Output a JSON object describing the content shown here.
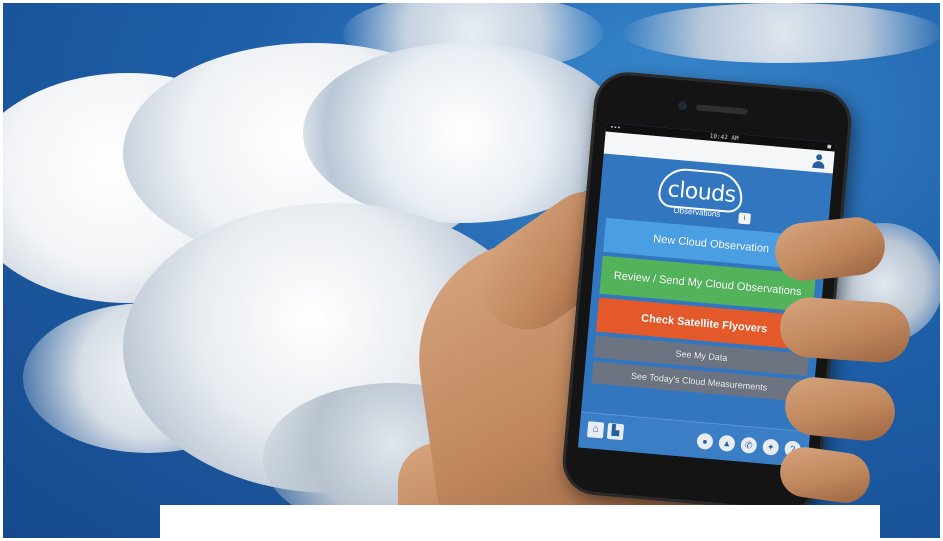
{
  "phone_app": {
    "status_bar": {
      "left": "•••",
      "center": "10:42 AM",
      "right": "■"
    },
    "logo": {
      "word": "clouds",
      "subtitle": "Observations",
      "badge": "i"
    },
    "buttons": {
      "new_observation": "New Cloud Observation",
      "review_send": "Review / Send My Cloud Observations",
      "check_satellite": "Check Satellite Flyovers",
      "see_my_data": "See My Data",
      "see_today": "See Today's Cloud Measurements"
    },
    "bottom_bar": {
      "left_icons": [
        "home-icon",
        "chart-icon"
      ],
      "left_glyphs": [
        "⌂",
        "▙"
      ],
      "right_icons": [
        "globe-icon",
        "pin-icon",
        "phone-icon",
        "satellite-icon",
        "help-icon"
      ],
      "right_glyphs": [
        "●",
        "▲",
        "✆",
        "✦",
        "?"
      ]
    }
  },
  "colors": {
    "sky": "#1e5fa8",
    "screen_bg": "#3276c0",
    "new_btn": "#4a9fe3",
    "review_btn": "#52b35a",
    "satellite_btn": "#e4592a",
    "gray_btn": "#6b7480"
  }
}
